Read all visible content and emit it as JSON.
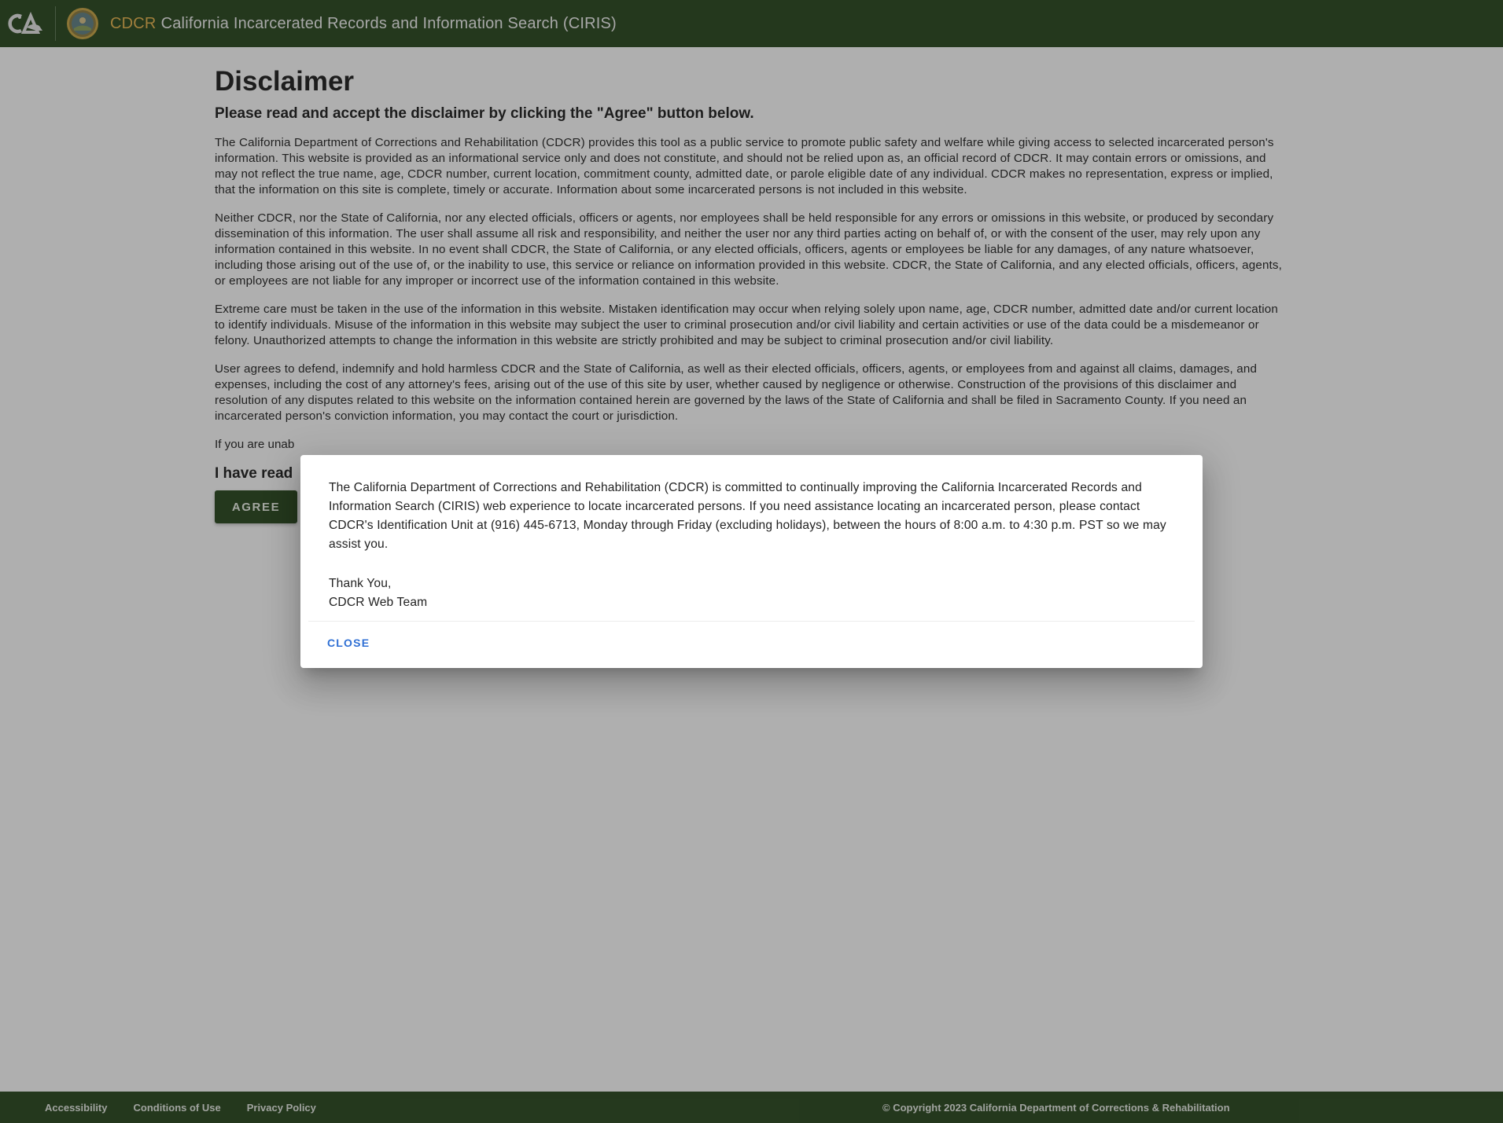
{
  "header": {
    "brand": "CDCR",
    "title": "California Incarcerated Records and Information Search (CIRIS)"
  },
  "main": {
    "title": "Disclaimer",
    "subtitle": "Please read and accept the disclaimer by clicking the \"Agree\" button below.",
    "paragraphs": [
      "The California Department of Corrections and Rehabilitation (CDCR) provides this tool as a public service to promote public safety and welfare while giving access to selected incarcerated person's information. This website is provided as an informational service only and does not constitute, and should not be relied upon as, an official record of CDCR. It may contain errors or omissions, and may not reflect the true name, age, CDCR number, current location, commitment county, admitted date, or parole eligible date of any individual. CDCR makes no representation, express or implied, that the information on this site is complete, timely or accurate. Information about some incarcerated persons is not included in this website.",
      "Neither CDCR, nor the State of California, nor any elected officials, officers or agents, nor employees shall be held responsible for any errors or omissions in this website, or produced by secondary dissemination of this information. The user shall assume all risk and responsibility, and neither the user nor any third parties acting on behalf of, or with the consent of the user, may rely upon any information contained in this website. In no event shall CDCR, the State of California, or any elected officials, officers, agents or employees be liable for any damages, of any nature whatsoever, including those arising out of the use of, or the inability to use, this service or reliance on information provided in this website. CDCR, the State of California, and any elected officials, officers, agents, or employees are not liable for any improper or incorrect use of the information contained in this website.",
      "Extreme care must be taken in the use of the information in this website. Mistaken identification may occur when relying solely upon name, age, CDCR number, admitted date and/or current location to identify individuals. Misuse of the information in this website may subject the user to criminal prosecution and/or civil liability and certain activities or use of the data could be a misdemeanor or felony. Unauthorized attempts to change the information in this website are strictly prohibited and may be subject to criminal prosecution and/or civil liability.",
      "User agrees to defend, indemnify and hold harmless CDCR and the State of California, as well as their elected officials, officers, agents, or employees from and against all claims, damages, and expenses, including the cost of any attorney's fees, arising out of the use of this site by user, whether caused by negligence or otherwise. Construction of the provisions of this disclaimer and resolution of any disputes related to this website on the information contained herein are governed by the laws of the State of California and shall be filed in Sacramento County. If you need an incarcerated person's conviction information, you may contact the court or jurisdiction."
    ],
    "partial_line": "If you are unab",
    "ack_partial": "I have read",
    "agree_label": "AGREE"
  },
  "dialog": {
    "message": "The California Department of Corrections and Rehabilitation (CDCR) is committed to continually improving the California Incarcerated Records and Information Search (CIRIS) web experience to locate incarcerated persons. If you need assistance locating an incarcerated person, please contact CDCR's Identification Unit at (916) 445-6713, Monday through Friday (excluding holidays), between the hours of 8:00 a.m. to 4:30 p.m. PST so we may assist you.",
    "sign_line1": "Thank You,",
    "sign_line2": "CDCR Web Team",
    "close_label": "CLOSE"
  },
  "footer": {
    "links": [
      "Accessibility",
      "Conditions of Use",
      "Privacy Policy"
    ],
    "copyright": "© Copyright 2023 California Department of Corrections & Rehabilitation"
  },
  "colors": {
    "header_bg": "#27461c",
    "brand_accent": "#e9b44c",
    "link_blue": "#2f6fd4"
  },
  "icons": [
    "ca-logo-icon",
    "state-seal-icon"
  ]
}
